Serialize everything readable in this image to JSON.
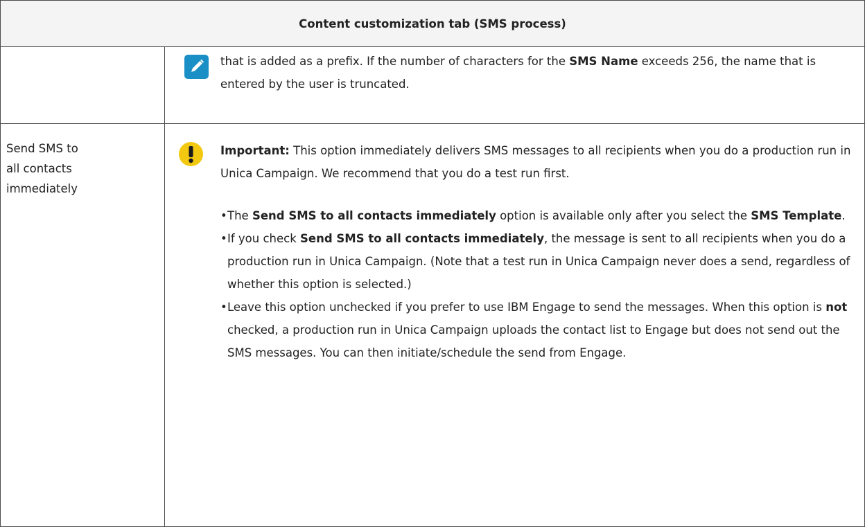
{
  "table": {
    "header": "Content customization tab (SMS process)",
    "row1": {
      "note_part1": "that is added as a prefix. If the number of characters for the ",
      "note_bold1": "SMS Name",
      "note_part2": " exceeds 256, the name that is entered by the user is truncated."
    },
    "row2": {
      "label_line1": "Send SMS to",
      "label_line2": "all contacts",
      "label_line3": "immediately",
      "important_label": "Important:",
      "important_text": " This option immediately delivers SMS messages to all recipients when you do a production run in Unica Campaign. We recommend that you do a test run first.",
      "bullet_char": "•",
      "bullet1": {
        "pre": "The ",
        "bold1": "Send SMS to all contacts immediately",
        "mid": " option is available only after you select the ",
        "bold2": "SMS Template",
        "post": "."
      },
      "bullet2": {
        "pre": "If you check ",
        "bold1": "Send SMS to all contacts immediately",
        "post": ", the message is sent to all recipients when you do a production run in Unica Campaign. (Note that a test run in Unica Campaign never does a send, regardless of whether this option is selected.)"
      },
      "bullet3": {
        "pre": "Leave this option unchecked if you prefer to use IBM Engage to send the messages. When this option is ",
        "bold1": "not",
        "post": " checked, a production run in Unica Campaign uploads the contact list to Engage but does not send out the SMS messages. You can then initiate/schedule the send from Engage."
      }
    }
  },
  "icons": {
    "note": "pencil-icon",
    "important": "exclamation-icon"
  },
  "colors": {
    "note_icon": "#1a8fc6",
    "important_icon": "#f2c811",
    "border": "#4a4a4a",
    "header_bg": "#f4f4f4"
  }
}
